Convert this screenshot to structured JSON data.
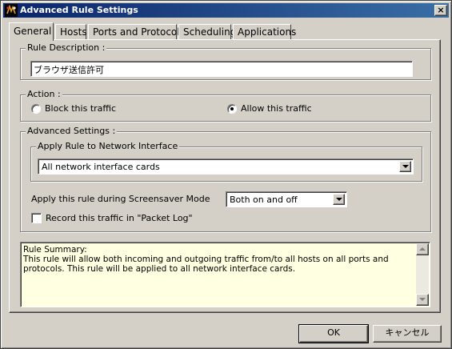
{
  "window": {
    "title": "Advanced Rule Settings",
    "app_icon": "app-icon",
    "close_label": "×"
  },
  "tabs": [
    {
      "label": "General",
      "active": true
    },
    {
      "label": "Hosts",
      "active": false
    },
    {
      "label": "Ports and Protocols",
      "active": false
    },
    {
      "label": "Scheduling",
      "active": false
    },
    {
      "label": "Applications",
      "active": false
    }
  ],
  "general": {
    "rule_description": {
      "legend": "Rule Description :",
      "value": "ブラウザ送信許可"
    },
    "action": {
      "legend": "Action :",
      "options": [
        {
          "label": "Block this traffic",
          "selected": false
        },
        {
          "label": "Allow this traffic",
          "selected": true
        }
      ]
    },
    "advanced": {
      "legend": "Advanced Settings :",
      "interface": {
        "legend": "Apply Rule to Network Interface",
        "selected": "All network interface cards"
      },
      "screensaver": {
        "label": "Apply this rule during Screensaver Mode",
        "selected": "Both on and off"
      },
      "packet_log": {
        "label": "Record this traffic in \"Packet Log\"",
        "checked": false
      }
    },
    "summary": {
      "lines": [
        "Rule Summary:",
        "This rule will allow both incoming and outgoing traffic from/to all hosts on all ports and",
        "protocols.  This rule will be applied to all network interface cards."
      ]
    }
  },
  "buttons": {
    "ok": "OK",
    "cancel": "キャンセル"
  },
  "colors": {
    "title_start": "#0a246a",
    "title_end": "#3a6ea5",
    "face": "#d4d0c8",
    "summary_bg": "#ffffe1"
  }
}
